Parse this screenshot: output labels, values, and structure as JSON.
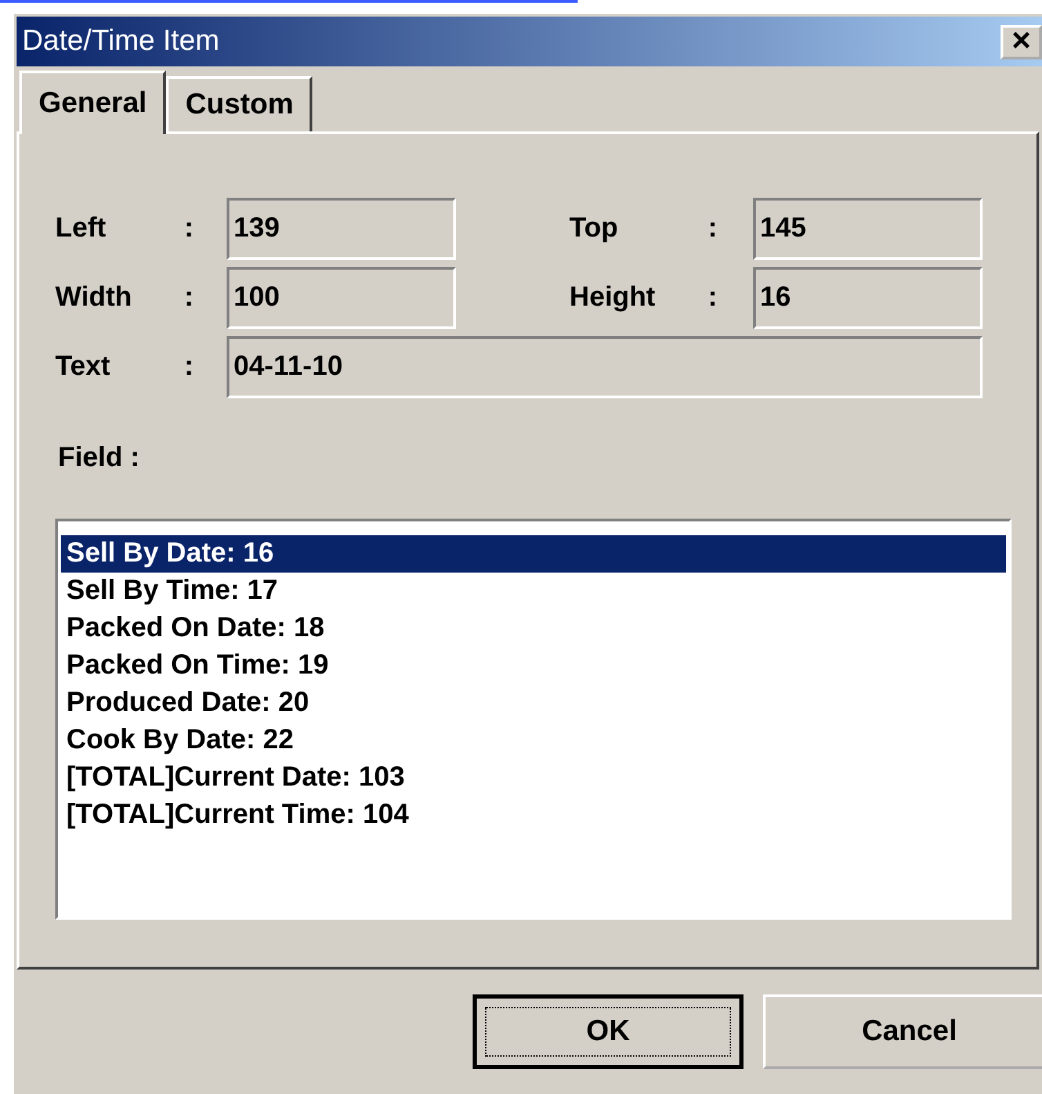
{
  "window": {
    "title": "Date/Time Item",
    "close": "×"
  },
  "tabs": [
    {
      "label": "General",
      "selected": true
    },
    {
      "label": "Custom",
      "selected": false
    }
  ],
  "fields": [
    {
      "label": "Left",
      "colon": ":",
      "value": "139"
    },
    {
      "label": "Top",
      "colon": ":",
      "value": "145"
    },
    {
      "label": "Width",
      "colon": ":",
      "value": "100"
    },
    {
      "label": "Height",
      "colon": ":",
      "value": "16"
    }
  ],
  "text_field": {
    "label": "Text",
    "colon": ":",
    "value": "04-11-10"
  },
  "field_label": "Field :",
  "field_list": [
    {
      "label": "Sell By Date: 16",
      "selected": true
    },
    {
      "label": "Sell By Time: 17",
      "selected": false
    },
    {
      "label": "Packed On Date: 18",
      "selected": false
    },
    {
      "label": "Packed On Time: 19",
      "selected": false
    },
    {
      "label": "Produced Date: 20",
      "selected": false
    },
    {
      "label": "Cook By Date: 22",
      "selected": false
    },
    {
      "label": "[TOTAL]Current Date: 103",
      "selected": false
    },
    {
      "label": "[TOTAL]Current Time: 104",
      "selected": false
    }
  ],
  "buttons": [
    {
      "label": "OK",
      "default": true
    },
    {
      "label": "Cancel",
      "default": false
    }
  ]
}
